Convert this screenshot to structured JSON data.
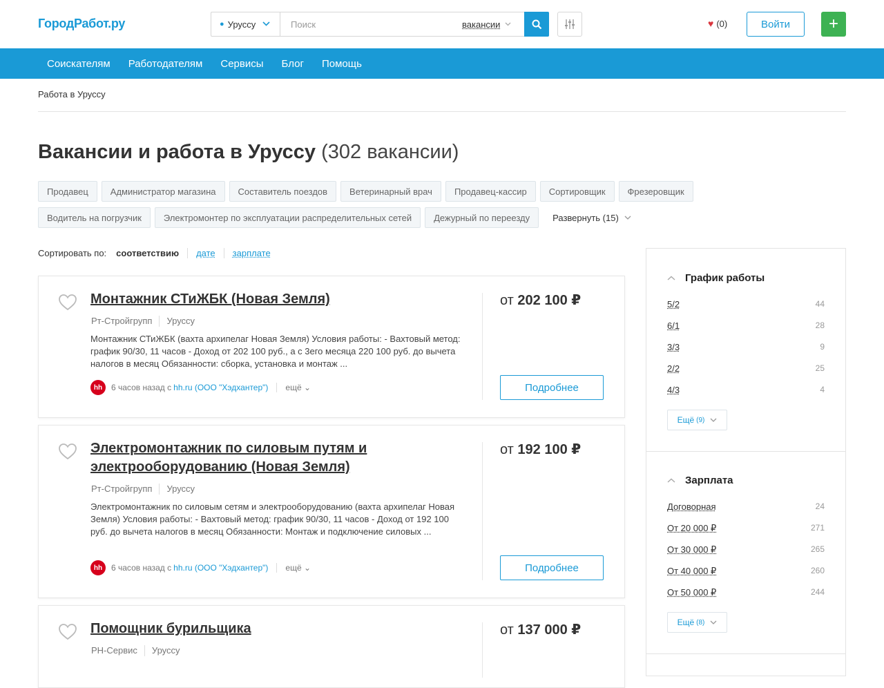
{
  "header": {
    "logo": "ГородРабот.ру",
    "city": "Уруссу",
    "search_placeholder": "Поиск",
    "search_type": "вакансии",
    "favorites_count": "(0)",
    "login_label": "Войти",
    "add_label": "+"
  },
  "nav": {
    "items": [
      "Соискателям",
      "Работодателям",
      "Сервисы",
      "Блог",
      "Помощь"
    ]
  },
  "breadcrumb": "Работа в Уруссу",
  "page": {
    "title": "Вакансии и работа в Уруссу",
    "count": "(302 вакансии)"
  },
  "tags": [
    "Продавец",
    "Администратор магазина",
    "Составитель поездов",
    "Ветеринарный врач",
    "Продавец-кассир",
    "Сортировщик",
    "Фрезеровщик",
    "Водитель на погрузчик",
    "Электромонтер по эксплуатации распределительных сетей",
    "Дежурный по переезду"
  ],
  "tags_expand": "Развернуть (15)",
  "sort": {
    "label": "Сортировать по:",
    "active": "соответствию",
    "options": [
      "дате",
      "зарплате"
    ]
  },
  "vacancies": [
    {
      "title": "Монтажник СТиЖБК (Новая Земля)",
      "company": "Рт-Стройгрупп",
      "city": "Уруссу",
      "description": "Монтажник СТиЖБК (вахта архипелаг Новая Земля) Условия работы: - Вахтовый метод: график 90/30, 11 часов - Доход от 202 100 руб., а с 3его месяца 220 100 руб. до вычета налогов в месяц Обязанности: сборка, установка и монтаж ...",
      "time": "6 часов назад с",
      "source": "hh.ru (ООО \"Хэдхантер\")",
      "more": "ещё",
      "salary_prefix": "от",
      "salary": "202 100",
      "currency": "₽",
      "details": "Подробнее"
    },
    {
      "title": "Электромонтажник по силовым путям и электрооборудованию (Новая Земля)",
      "company": "Рт-Стройгрупп",
      "city": "Уруссу",
      "description": "Электромонтажник по силовым сетям и электрооборудованию (вахта архипелаг Новая Земля) Условия работы: - Вахтовый метод: график 90/30, 11 часов - Доход от 192 100 руб. до вычета налогов в месяц Обязанности: Монтаж и подключение силовых ...",
      "time": "6 часов назад с",
      "source": "hh.ru (ООО \"Хэдхантер\")",
      "more": "ещё",
      "salary_prefix": "от",
      "salary": "192 100",
      "currency": "₽",
      "details": "Подробнее"
    },
    {
      "title": "Помощник бурильщика",
      "company": "РН-Сервис",
      "city": "Уруссу",
      "salary_prefix": "от",
      "salary": "137 000",
      "currency": "₽"
    }
  ],
  "facets": [
    {
      "title": "График работы",
      "rows": [
        {
          "label": "5/2",
          "count": "44"
        },
        {
          "label": "6/1",
          "count": "28"
        },
        {
          "label": "3/3",
          "count": "9"
        },
        {
          "label": "2/2",
          "count": "25"
        },
        {
          "label": "4/3",
          "count": "4"
        }
      ],
      "more": "Ещё",
      "more_count": "(9)"
    },
    {
      "title": "Зарплата",
      "rows": [
        {
          "label": "Договорная",
          "count": "24"
        },
        {
          "label": "От 20 000 ₽",
          "count": "271"
        },
        {
          "label": "От 30 000 ₽",
          "count": "265"
        },
        {
          "label": "От 40 000 ₽",
          "count": "260"
        },
        {
          "label": "От 50 000 ₽",
          "count": "244"
        }
      ],
      "more": "Ещё",
      "more_count": "(8)"
    }
  ]
}
